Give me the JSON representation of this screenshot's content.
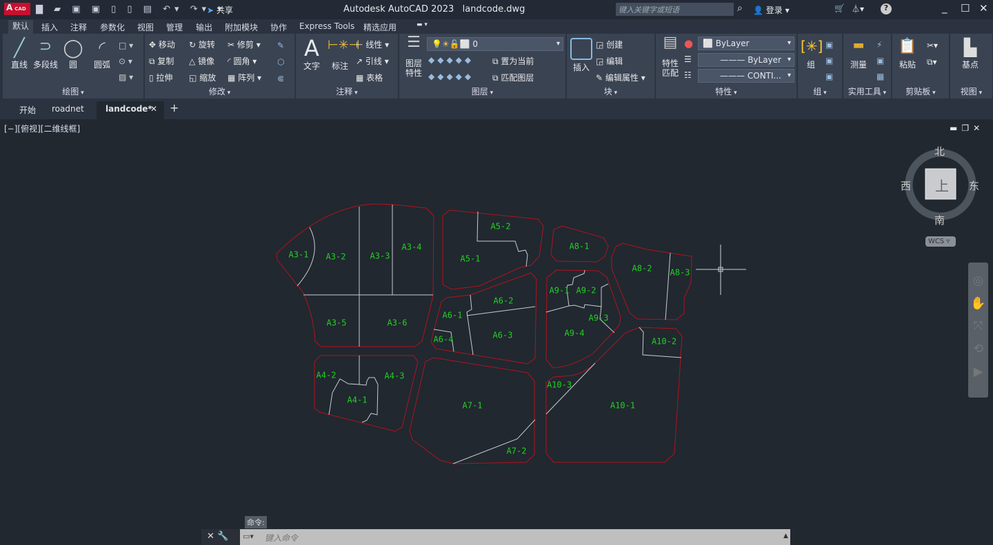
{
  "app": {
    "logo": "A",
    "logo_sub": "CAD",
    "title": "Autodesk AutoCAD 2023",
    "filename": "landcode.dwg",
    "share": "共享",
    "search_placeholder": "键入关键字或短语",
    "login": "登录"
  },
  "menu_tabs": [
    "默认",
    "插入",
    "注释",
    "参数化",
    "视图",
    "管理",
    "输出",
    "附加模块",
    "协作",
    "Express Tools",
    "精选应用"
  ],
  "ribbon": {
    "draw": {
      "title": "绘图",
      "items": [
        "直线",
        "多段线",
        "圆",
        "圆弧"
      ]
    },
    "modify": {
      "title": "修改",
      "items": [
        "移动",
        "旋转",
        "修剪",
        "复制",
        "镜像",
        "圆角",
        "拉伸",
        "缩放",
        "阵列"
      ]
    },
    "annotation": {
      "title": "注释",
      "items": [
        "文字",
        "标注",
        "线性",
        "引线",
        "表格"
      ]
    },
    "layers": {
      "title": "图层",
      "props": "图层\n特性",
      "current_layer": "0",
      "set_current": "置为当前",
      "match_layer": "匹配图层"
    },
    "block": {
      "title": "块",
      "insert": "插入",
      "create": "创建",
      "edit": "编辑",
      "edit_attr": "编辑属性"
    },
    "properties": {
      "title": "特性",
      "match": "特性\n匹配",
      "color": "ByLayer",
      "lineweight": "ByLayer",
      "linetype": "CONTI..."
    },
    "group": {
      "title": "组",
      "label": "组"
    },
    "utilities": {
      "title": "实用工具",
      "measure": "测量"
    },
    "clipboard": {
      "title": "剪贴板",
      "paste": "粘贴"
    },
    "view": {
      "title": "视图",
      "base": "基点"
    }
  },
  "doc_tabs": [
    "开始",
    "roadnet",
    "landcode*"
  ],
  "viewport_label": "[−][俯视][二维线框]",
  "viewcube": {
    "north": "北",
    "south": "南",
    "east": "东",
    "west": "西",
    "face": "上",
    "ucs": "WCS"
  },
  "parcels": [
    "A3-1",
    "A3-2",
    "A3-3",
    "A3-4",
    "A3-5",
    "A3-6",
    "A4-1",
    "A4-2",
    "A4-3",
    "A5-1",
    "A5-2",
    "A6-1",
    "A6-2",
    "A6-3",
    "A6-4",
    "A7-1",
    "A7-2",
    "A8-1",
    "A8-2",
    "A8-3",
    "A9-1",
    "A9-2",
    "A9-3",
    "A9-4",
    "A10-1",
    "A10-2",
    "A10-3"
  ],
  "command": {
    "prompt": "命令:",
    "placeholder": "键入命令"
  }
}
